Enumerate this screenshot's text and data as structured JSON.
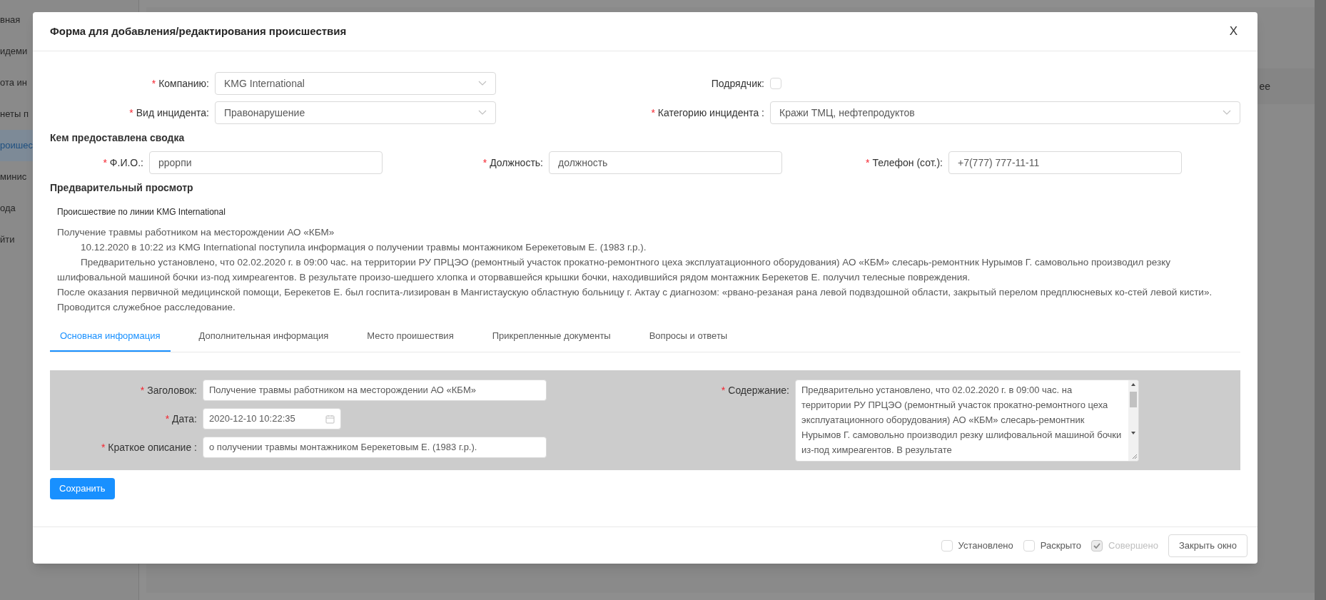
{
  "background": {
    "sidebar_items": [
      {
        "label": "вная",
        "selected": false
      },
      {
        "label": "идеми",
        "selected": false
      },
      {
        "label": "ота ин",
        "selected": false
      },
      {
        "label": "неты п",
        "selected": false
      },
      {
        "label": "роишес",
        "selected": true
      },
      {
        "label": "минис",
        "selected": false
      },
      {
        "label": "ода",
        "selected": false
      },
      {
        "label": "йти",
        "selected": false
      }
    ],
    "column_header": "ее"
  },
  "modal": {
    "title": "Форма для добавления/редактирования происшествия",
    "close": "X",
    "required_mark": "*",
    "company": {
      "label": "Компанию:",
      "required": true,
      "value": "KMG International"
    },
    "contractor": {
      "label": "Подрядчик:",
      "checked": false
    },
    "incident_type": {
      "label": "Вид инцидента:",
      "required": true,
      "value": "Правонарушение"
    },
    "incident_category": {
      "label": "Категорию инцидента :",
      "required": true,
      "value": "Кражи ТМЦ, нефтепродуктов"
    },
    "reporter_heading": "Кем предоставлена сводка",
    "reporter_fields": [
      {
        "label": "Ф.И.О.:",
        "required": true,
        "value": "ррорпи"
      },
      {
        "label": "Должность:",
        "required": true,
        "value": "должность"
      },
      {
        "label": "Телефон (сот.):",
        "required": true,
        "value": "+7(777) 777-11-11"
      }
    ],
    "preview_heading": "Предварительный просмотр",
    "preview": {
      "title": "Происшествие по линии KMG International",
      "paragraphs": [
        {
          "text": "Получение травмы работником на месторождении АО «КБМ»",
          "indented": false
        },
        {
          "text": "10.12.2020 в 10:22 из KMG International поступила информация о получении травмы монтажником Берекетовым Е. (1983 г.р.).",
          "indented": true
        },
        {
          "text": "Предварительно установлено, что 02.02.2020 г. в 09:00 час. на территории РУ ПРЦЭО (ремонтный участок прокатно-ремонтного цеха эксплуатационного оборудования) АО «КБМ» слесарь-ремонтник Нурымов Г. самовольно производил резку шлифовальной машиной бочки из-под химреагентов. В результате произо-шедшего хлопка и оторвавшейся крышки бочки, находившийся рядом монтажник Берекетов Е. получил телесные повреждения.",
          "indented": true
        },
        {
          "text": "После оказания первичной медицинской помощи, Берекетов Е. был госпита-лизирован в Мангистаускую областную больницу г. Актау с диагнозом: «рвано-резаная рана левой подвздошной области, закрытый перелом предплюсневых ко-стей левой кисти».",
          "indented": false
        },
        {
          "text": "Проводится служебное расследование.",
          "indented": false
        }
      ]
    },
    "tabs": [
      {
        "label": "Основная информация",
        "selected": true
      },
      {
        "label": "Дополнительная информация",
        "selected": false
      },
      {
        "label": "Место проишествия",
        "selected": false
      },
      {
        "label": "Прикрепленные документы",
        "selected": false
      },
      {
        "label": "Вопросы и ответы",
        "selected": false
      }
    ],
    "main_fields": [
      {
        "label": "Заголовок:",
        "required": true,
        "value": "Получение травмы работником на месторождении АО «КБМ»",
        "kind": "text"
      },
      {
        "label": "Дата:",
        "required": true,
        "value": "2020-12-10 10:22:35",
        "kind": "date"
      },
      {
        "label": "Краткое описание :",
        "required": true,
        "value": "о получении травмы монтажником Берекетовым Е. (1983 г.р.).",
        "kind": "text"
      }
    ],
    "content_field": {
      "label": "Содержание:",
      "required": true,
      "value": "Предварительно установлено, что 02.02.2020 г. в 09:00 час. на территории РУ ПРЦЭО (ремонтный участок прокатно-ремонтного цеха эксплуатационного оборудования) АО «КБМ» слесарь-ремонтник Нурымов Г. самовольно производил резку шлифовальной машиной бочки из-под химреагентов. В результате"
    },
    "save_button": "Сохранить",
    "footer_checks": [
      {
        "label": "Установлено",
        "checked": false,
        "disabled": false
      },
      {
        "label": "Раскрыто",
        "checked": false,
        "disabled": false
      },
      {
        "label": "Совершено",
        "checked": true,
        "disabled": true
      }
    ],
    "close_button": "Закрыть окно"
  }
}
